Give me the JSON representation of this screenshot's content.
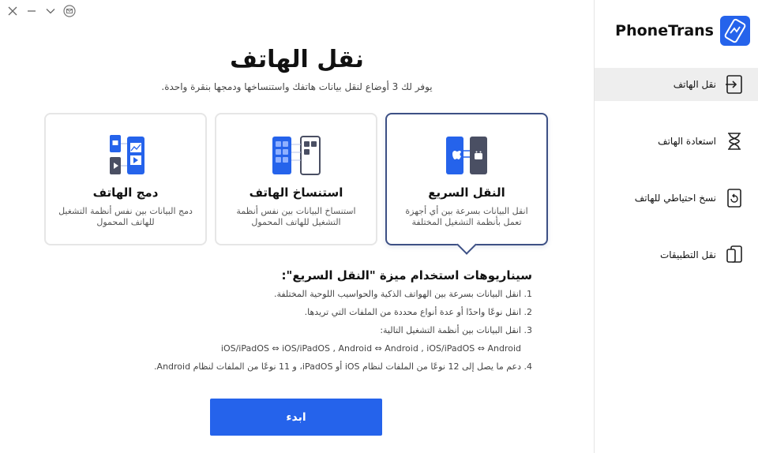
{
  "main": {
    "title": "نقل الهاتف",
    "subtitle": "يوفر لك 3 أوضاع لنقل بيانات هاتفك واستنساخها ودمجها بنقرة واحدة.",
    "cards": [
      {
        "title": "النقل السريع",
        "desc": "انقل البيانات بسرعة بين أي أجهزة تعمل بأنظمة التشغيل المختلفة",
        "active": true
      },
      {
        "title": "استنساخ الهاتف",
        "desc": "استنساخ البيانات بين نفس أنظمة التشغيل للهاتف المحمول",
        "active": false
      },
      {
        "title": "دمج الهاتف",
        "desc": "دمج البيانات بين نفس أنظمة التشغيل للهاتف المحمول",
        "active": false
      }
    ],
    "scenarios_title": "سيناريوهات استخدام ميزة \"النقل السريع\":",
    "scenarios": [
      "1. انقل البيانات بسرعة بين الهواتف الذكية والحواسيب اللوحية المختلفة.",
      "2. انقل نوعًا واحدًا أو عدة أنواع محددة من الملفات التي تريدها.",
      "3. انقل البيانات بين أنظمة التشغيل التالية:",
      "iOS/iPadOS ⇔ iOS/iPadOS ,  Android ⇔ Android ,  iOS/iPadOS ⇔ Android",
      "4. دعم ما يصل إلى 12 نوعًا من الملفات لنظام iOS أو iPadOS، و 11 نوعًا من الملفات لنظام Android."
    ],
    "start_label": "ابدء"
  },
  "sidebar": {
    "brand": "PhoneTrans",
    "items": [
      {
        "label": "نقل الهاتف",
        "icon": "phone-transfer-icon",
        "active": true
      },
      {
        "label": "استعادة الهاتف",
        "icon": "hourglass-icon",
        "active": false
      },
      {
        "label": "نسخ احتياطي للهاتف",
        "icon": "backup-icon",
        "active": false
      },
      {
        "label": "نقل التطبيقات",
        "icon": "app-transfer-icon",
        "active": false
      }
    ]
  },
  "colors": {
    "accent": "#2563eb",
    "active_card_border": "#3d5085",
    "sidebar_active_bg": "#eeeeee"
  }
}
